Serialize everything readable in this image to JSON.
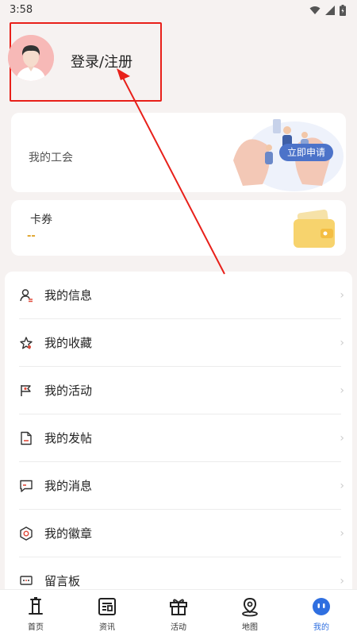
{
  "status": {
    "time": "3:58"
  },
  "profile": {
    "login_label": "登录/注册"
  },
  "union": {
    "title": "我的工会",
    "apply_label": "立即申请"
  },
  "coupon": {
    "title": "卡券",
    "value": "--"
  },
  "menu": {
    "items": [
      {
        "label": "我的信息"
      },
      {
        "label": "我的收藏"
      },
      {
        "label": "我的活动"
      },
      {
        "label": "我的发帖"
      },
      {
        "label": "我的消息"
      },
      {
        "label": "我的徽章"
      },
      {
        "label": "留言板"
      }
    ]
  },
  "tabs": [
    {
      "label": "首页"
    },
    {
      "label": "资讯"
    },
    {
      "label": "活动"
    },
    {
      "label": "地图"
    },
    {
      "label": "我的"
    }
  ],
  "colors": {
    "accent": "#2f6fe0",
    "highlight": "#e8201a",
    "apply": "#4c73c9"
  }
}
